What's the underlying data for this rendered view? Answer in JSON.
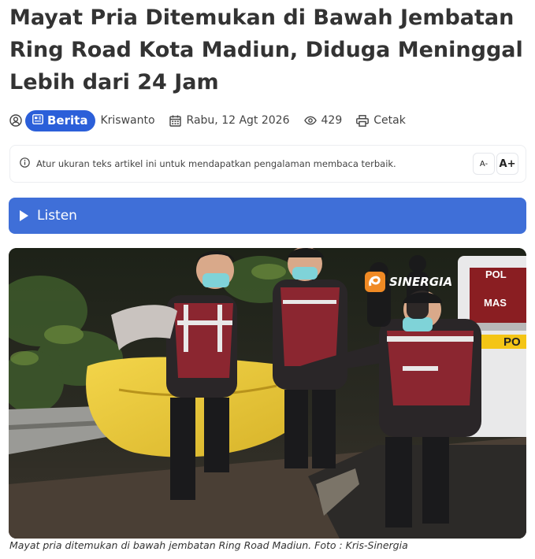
{
  "article": {
    "title": "Mayat Pria Ditemukan di Bawah Jembatan Ring Road Kota Madiun, Diduga Meninggal Lebih dari 24 Jam",
    "category": "Berita",
    "author": "Kriswanto",
    "date": "Rabu, 12 Agt 2026",
    "views": "429",
    "print_label": "Cetak"
  },
  "notice": {
    "text": "Atur ukuran teks artikel ini untuk mendapatkan pengalaman membaca terbaik.",
    "smaller_label": "A-",
    "larger_label": "A+"
  },
  "listen": {
    "label": "Listen"
  },
  "photo": {
    "watermark": "SINERGIA",
    "police_car_text_1": "POL",
    "police_car_text_2": "MAS",
    "police_car_text_3": "PO",
    "caption": "Mayat pria ditemukan di bawah jembatan Ring Road Madiun. Foto : Kris-Sinergia"
  },
  "colors": {
    "accent": "#2b5fd9",
    "listen_bg": "#3f6fd8"
  },
  "icons": [
    "user-icon",
    "news-icon",
    "calendar-icon",
    "eye-icon",
    "printer-icon",
    "info-icon",
    "play-icon"
  ]
}
